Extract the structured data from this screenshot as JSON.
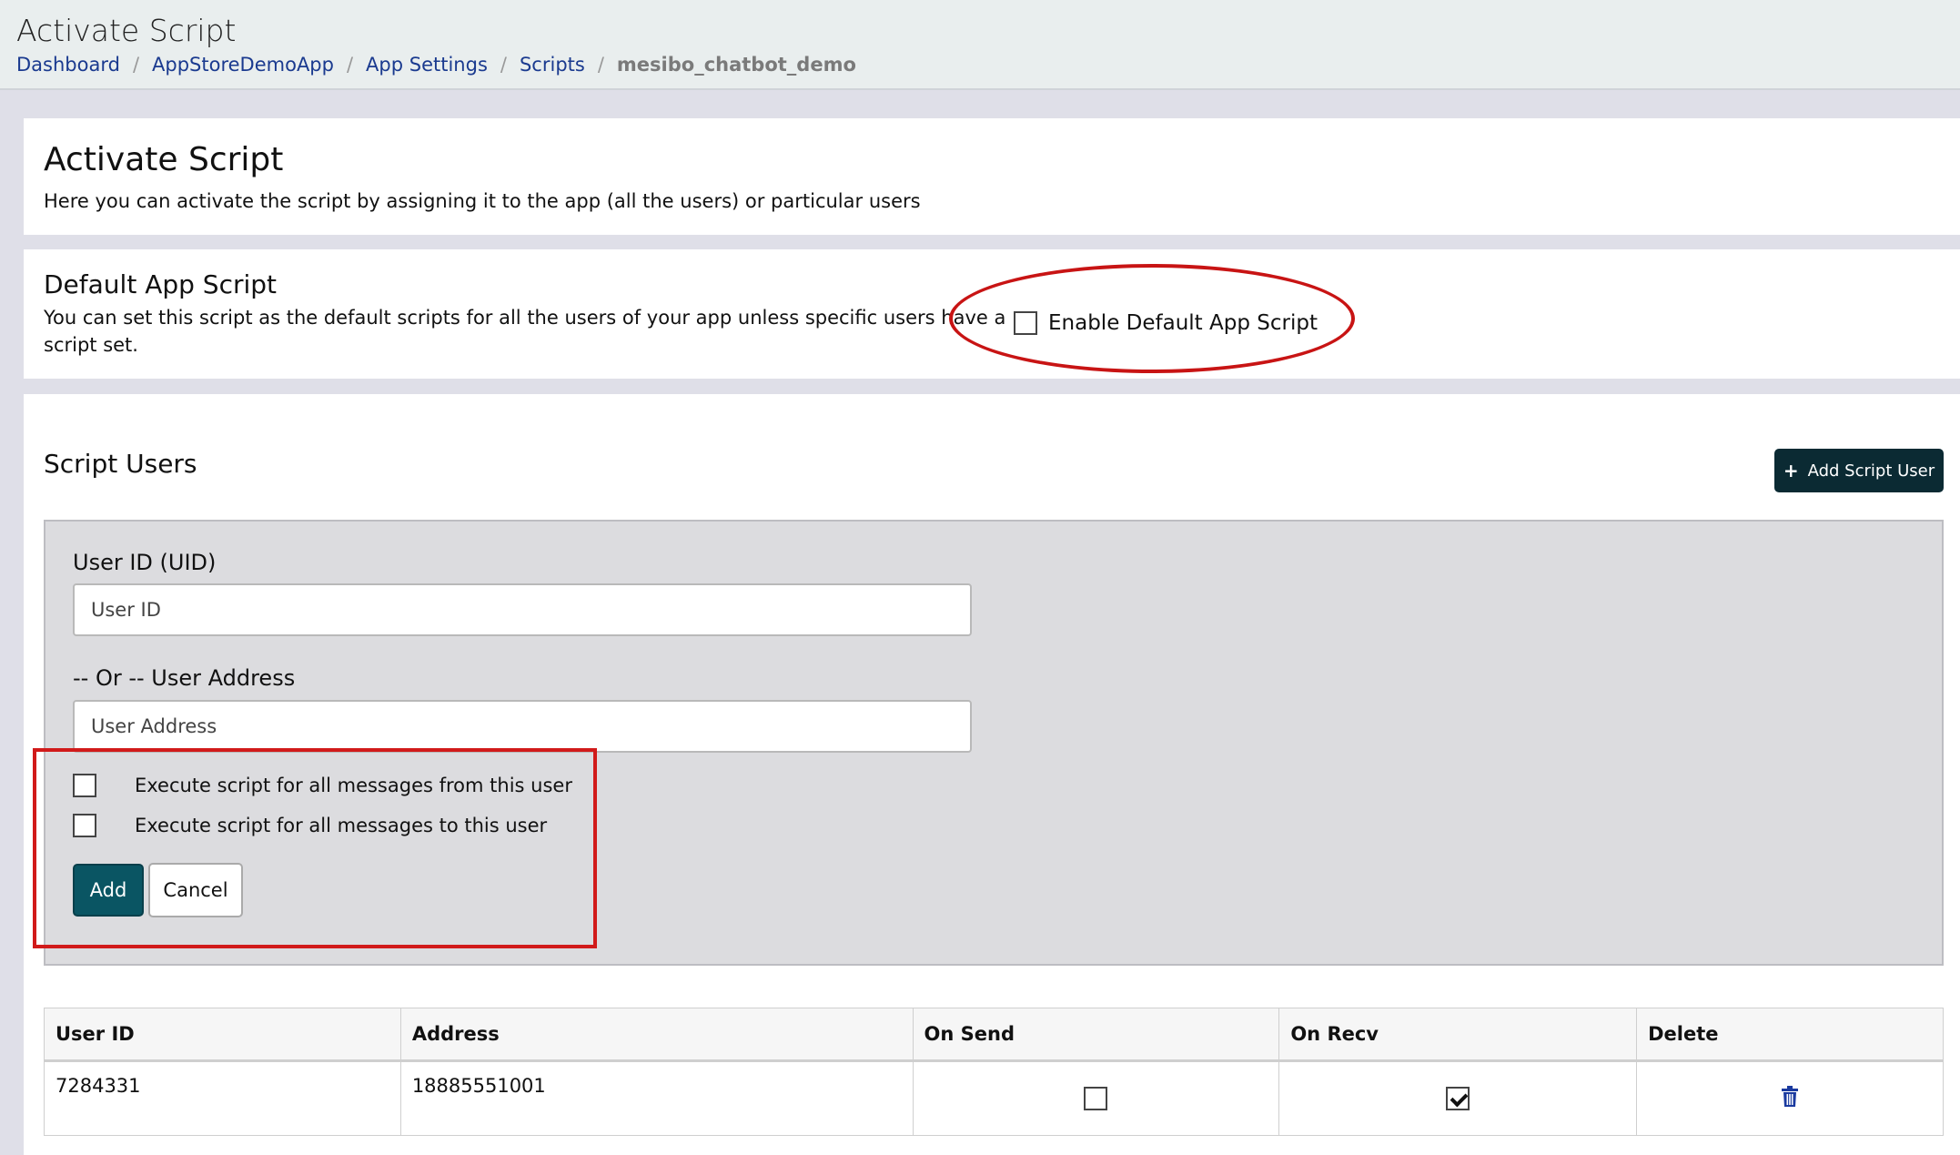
{
  "header": {
    "title": "Activate Script",
    "breadcrumb": {
      "items": [
        "Dashboard",
        "AppStoreDemoApp",
        "App Settings",
        "Scripts"
      ],
      "current": "mesibo_chatbot_demo"
    }
  },
  "intro": {
    "title": "Activate Script",
    "description": "Here you can activate the script by assigning it to the app (all the users) or particular users"
  },
  "default_script": {
    "title": "Default App Script",
    "description_line1": "You can set this script as the default scripts for all the users of your app unless specific users have a",
    "description_line2": "script set.",
    "checkbox_label": "Enable Default App Script",
    "enabled": false
  },
  "script_users": {
    "title": "Script Users",
    "add_button_label": "Add Script User",
    "form": {
      "uid_label": "User ID (UID)",
      "uid_placeholder": "User ID",
      "address_label": "-- Or -- User Address",
      "address_placeholder": "User Address",
      "from_label": "Execute script for all messages from this user",
      "to_label": "Execute script for all messages to this user",
      "add_label": "Add",
      "cancel_label": "Cancel"
    },
    "table": {
      "headers": [
        "User ID",
        "Address",
        "On Send",
        "On Recv",
        "Delete"
      ],
      "rows": [
        {
          "user_id": "7284331",
          "address": "18885551001",
          "on_send": false,
          "on_recv": true
        }
      ]
    }
  },
  "colors": {
    "annotation_red": "#c81414",
    "dark_button": "#0b2a33",
    "add_button": "#0a5563",
    "link": "#1a3a8f"
  }
}
